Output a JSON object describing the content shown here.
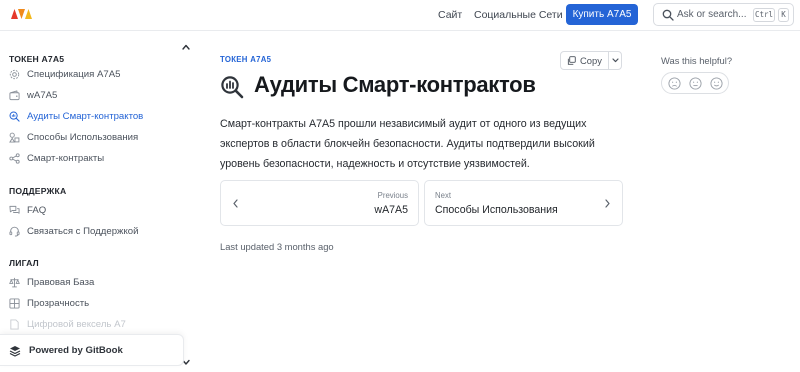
{
  "header": {
    "nav": [
      "Сайт",
      "Социальные Сети"
    ],
    "buy_label": "Купить A7A5",
    "search_placeholder": "Ask or search...",
    "shortcut_keys": [
      "Ctrl",
      "K"
    ],
    "logo_colors": [
      "#e5392b",
      "#f08a1c",
      "#f2b81d"
    ]
  },
  "sidebar": {
    "sections": [
      {
        "title": "ТОКЕН A7A5",
        "items": [
          {
            "label": "Спецификация A7A5",
            "icon": "gear-icon"
          },
          {
            "label": "wA7A5",
            "icon": "wallet-icon"
          },
          {
            "label": "Аудиты Смарт-контрактов",
            "icon": "magnifier-chart-icon",
            "active": true
          },
          {
            "label": "Способы Использования",
            "icon": "shapes-icon"
          },
          {
            "label": "Смарт-контракты",
            "icon": "nodes-icon"
          }
        ]
      },
      {
        "title": "ПОДДЕРЖКА",
        "items": [
          {
            "label": "FAQ",
            "icon": "chat-bubbles-icon"
          },
          {
            "label": "Связаться с Поддержкой",
            "icon": "headset-icon"
          }
        ]
      },
      {
        "title": "ЛИГАЛ",
        "items": [
          {
            "label": "Правовая База",
            "icon": "scale-icon"
          },
          {
            "label": "Прозрачность",
            "icon": "grid-icon"
          },
          {
            "label": "Цифровой вексель A7",
            "icon": "document-icon"
          }
        ]
      }
    ],
    "powered_by": "Powered by GitBook"
  },
  "main": {
    "breadcrumb": "ТОКЕН A7A5",
    "copy_label": "Copy",
    "title": "Аудиты Смарт-контрактов",
    "description": "Смарт-контракты A7A5 прошли независимый аудит от одного из ведущих экспертов в области блокчейн безопасности. Аудиты подтвердили высокий уровень безопасности, надежность и отсутствие уязвимостей.",
    "previous": {
      "caption": "Previous",
      "title": "wA7A5"
    },
    "next": {
      "caption": "Next",
      "title": "Способы Использования"
    },
    "last_updated": "Last updated 3 months ago"
  },
  "feedback": {
    "question": "Was this helpful?",
    "options": [
      "sad-face-icon",
      "neutral-face-icon",
      "happy-face-icon"
    ]
  },
  "colors": {
    "accent": "#2464d6",
    "text": "#1f2328",
    "muted": "#5a616b",
    "border": "#e2e5e9"
  }
}
